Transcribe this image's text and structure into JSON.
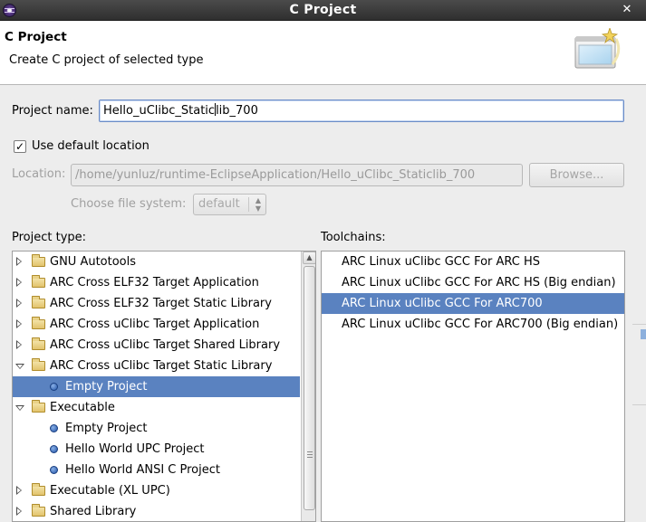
{
  "window": {
    "title": "C Project",
    "close_glyph": "✕"
  },
  "header": {
    "title": "C Project",
    "description": "Create C project of selected type",
    "wizard_icon": "new-project-wizard-icon"
  },
  "form": {
    "project_name_label": "Project name:",
    "project_name_value_before_caret": "Hello_uClibc_Static",
    "project_name_value_after_caret": "lib_700",
    "use_default_location_label": "Use default location",
    "use_default_location_checked": true,
    "location_label": "Location:",
    "location_value": "/home/yunluz/runtime-EclipseApplication/Hello_uClibc_Staticlib_700",
    "browse_label": "Browse...",
    "file_system_label": "Choose file system:",
    "file_system_value": "default"
  },
  "project_type": {
    "label": "Project type:",
    "items": [
      {
        "label": "GNU Autotools",
        "kind": "folder",
        "state": "collapsed"
      },
      {
        "label": "ARC Cross ELF32 Target Application",
        "kind": "folder",
        "state": "collapsed"
      },
      {
        "label": "ARC Cross ELF32 Target Static Library",
        "kind": "folder",
        "state": "collapsed"
      },
      {
        "label": "ARC Cross uClibc Target Application",
        "kind": "folder",
        "state": "collapsed"
      },
      {
        "label": "ARC Cross uClibc Target Shared Library",
        "kind": "folder",
        "state": "collapsed"
      },
      {
        "label": "ARC Cross uClibc Target Static Library",
        "kind": "folder",
        "state": "expanded"
      },
      {
        "label": "Empty Project",
        "kind": "item",
        "selected": true
      },
      {
        "label": "Executable",
        "kind": "folder",
        "state": "expanded"
      },
      {
        "label": "Empty Project",
        "kind": "item"
      },
      {
        "label": "Hello World UPC Project",
        "kind": "item"
      },
      {
        "label": "Hello World ANSI C Project",
        "kind": "item"
      },
      {
        "label": "Executable (XL UPC)",
        "kind": "folder",
        "state": "collapsed"
      },
      {
        "label": "Shared Library",
        "kind": "folder",
        "state": "collapsed"
      }
    ]
  },
  "toolchains": {
    "label": "Toolchains:",
    "items": [
      {
        "label": "ARC Linux uClibc GCC For ARC HS"
      },
      {
        "label": "ARC Linux uClibc GCC For ARC HS (Big endian)"
      },
      {
        "label": "ARC Linux uClibc GCC For ARC700",
        "selected": true
      },
      {
        "label": "ARC Linux uClibc GCC For ARC700 (Big endian)"
      }
    ]
  },
  "colors": {
    "selection": "#5a82c0",
    "titlebar": "#3a3a3a",
    "disabled_text": "#a0a0a0"
  }
}
